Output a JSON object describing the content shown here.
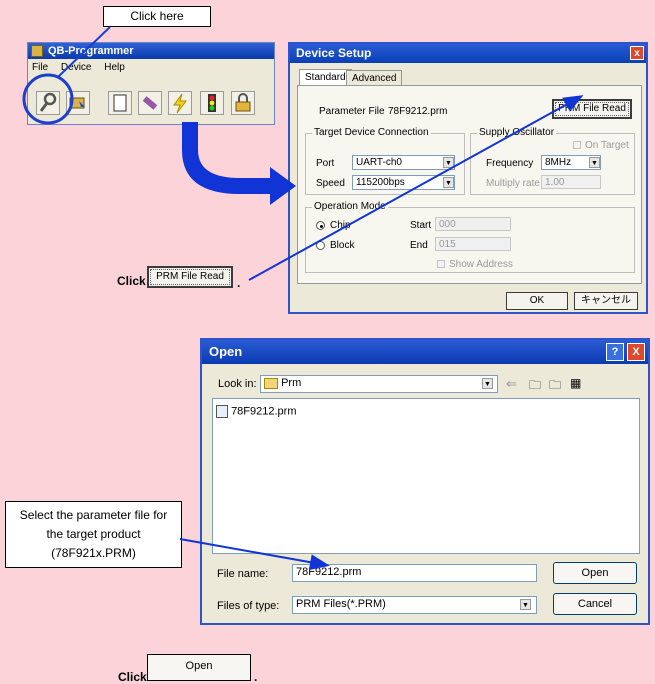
{
  "callouts": {
    "click_here": "Click here",
    "select_param": "Select the parameter file for the target product (78F921x.PRM)",
    "click_word_1": "Click",
    "click_word_2": "Click",
    "period": "."
  },
  "qb": {
    "title": "QB-Programmer",
    "menu": [
      "File",
      "Device",
      "Help"
    ]
  },
  "device_setup": {
    "title": "Device Setup",
    "tabs": [
      "Standard",
      "Advanced"
    ],
    "parameter_file_label": "Parameter File",
    "parameter_file_value": "78F9212.prm",
    "prm_button": "PRM File Read",
    "tdc_group": "Target Device Connection",
    "port_label": "Port",
    "port_value": "UART-ch0",
    "speed_label": "Speed",
    "speed_value": "115200bps",
    "supply_group": "Supply Oscillator",
    "on_target": "On Target",
    "frequency_label": "Frequency",
    "frequency_value": "8MHz",
    "multiply_label": "Multiply rate",
    "multiply_value": "1.00",
    "op_group": "Operation Mode",
    "chip": "Chip",
    "block": "Block",
    "start_label": "Start",
    "start_value": "000",
    "end_label": "End",
    "end_value": "015",
    "show_address": "Show Address",
    "ok": "OK",
    "cancel": "キャンセル"
  },
  "open_dialog": {
    "title": "Open",
    "look_in_label": "Look in:",
    "look_in_value": "Prm",
    "file_item": "78F9212.prm",
    "file_name_label": "File name:",
    "file_name_value": "78F9212.prm",
    "files_of_type_label": "Files of type:",
    "files_of_type_value": "PRM Files(*.PRM)",
    "open_button": "Open",
    "cancel_button": "Cancel",
    "help_btn": "?",
    "close_btn": "X"
  },
  "inline_buttons": {
    "prm_file_read": "PRM File Read",
    "open": "Open"
  },
  "colors": {
    "background": "#fcd3d9",
    "arrow_blue": "#1034d6",
    "highlight_circle": "#1d3fd0"
  }
}
